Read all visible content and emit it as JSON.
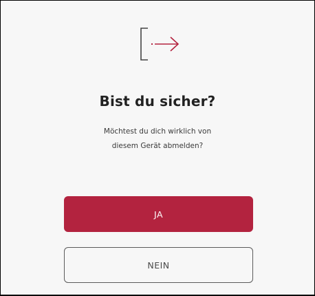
{
  "dialog": {
    "icon": "logout-icon",
    "title": "Bist du sicher?",
    "message_line1": "Möchtest du dich wirklich von",
    "message_line2": "diesem Gerät abmelden?",
    "confirm_label": "JA",
    "cancel_label": "NEIN"
  },
  "colors": {
    "accent": "#b3233f",
    "background": "#f7f7f7",
    "text": "#222222"
  }
}
